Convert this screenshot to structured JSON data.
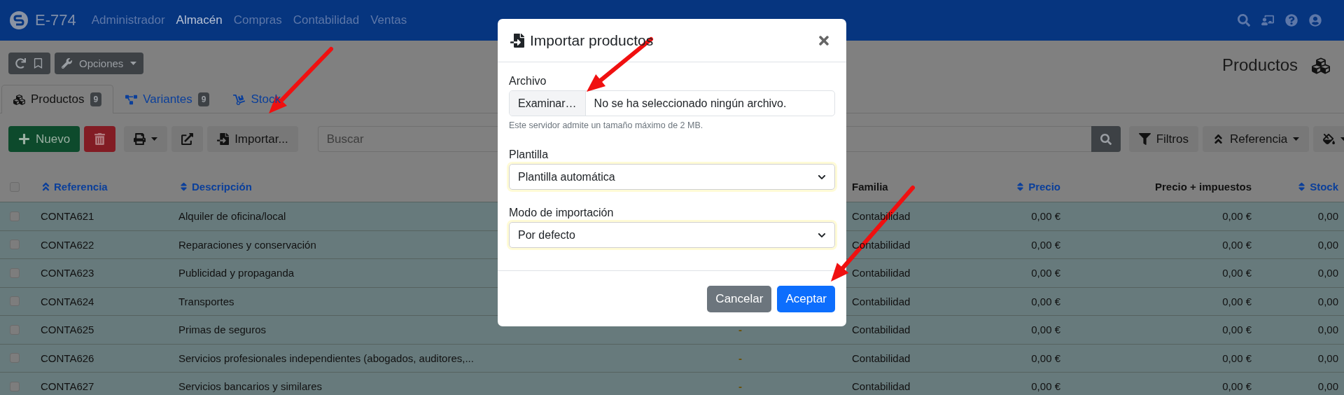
{
  "navbar": {
    "brand": "E-774",
    "menu": [
      {
        "label": "Administrador",
        "selected": false
      },
      {
        "label": "Almacén",
        "selected": true
      },
      {
        "label": "Compras",
        "selected": false
      },
      {
        "label": "Contabilidad",
        "selected": false
      },
      {
        "label": "Ventas",
        "selected": false
      }
    ]
  },
  "toolbar": {
    "options": "Opciones",
    "page_title": "Productos"
  },
  "tabs": [
    {
      "label": "Productos",
      "badge": "9",
      "selected": true,
      "kind": "cubes"
    },
    {
      "label": "Variantes",
      "badge": "9",
      "selected": false,
      "kind": "variants"
    },
    {
      "label": "Stock",
      "selected": false,
      "kind": "stock"
    }
  ],
  "actions": {
    "new": "Nuevo",
    "import": "Importar...",
    "search": {
      "placeholder": "Buscar"
    },
    "filters": "Filtros",
    "sort": "Referencia"
  },
  "table": {
    "select_all": {
      "checked": false
    },
    "columns": [
      {
        "label": "Referencia",
        "sortable": true,
        "sorted": true,
        "kind": "text"
      },
      {
        "label": "Descripción",
        "sortable": true,
        "sorted": false,
        "kind": "text"
      },
      {
        "kind": "text"
      },
      {
        "label": "Familia",
        "sortable": false,
        "sorted": false,
        "kind": "text"
      },
      {
        "label": "Precio",
        "sortable": true,
        "sorted": false,
        "kind": "number"
      },
      {
        "label": "Precio + impuestos",
        "sortable": false,
        "sorted": false,
        "kind": "number"
      },
      {
        "label": "Stock",
        "sortable": true,
        "sorted": false,
        "kind": "number"
      }
    ],
    "rows": [
      {
        "checked": false,
        "cells": [
          "CONTA621",
          "Alquiler de oficina/local",
          "",
          "Contabilidad",
          "0,00 €",
          "0,00 €",
          "0,00"
        ]
      },
      {
        "checked": false,
        "cells": [
          "CONTA622",
          "Reparaciones y conservación",
          "",
          "Contabilidad",
          "0,00 €",
          "0,00 €",
          "0,00"
        ]
      },
      {
        "checked": false,
        "cells": [
          "CONTA623",
          "Publicidad y propaganda",
          "",
          "Contabilidad",
          "0,00 €",
          "0,00 €",
          "0,00"
        ]
      },
      {
        "checked": false,
        "cells": [
          "CONTA624",
          "Transportes",
          "",
          "Contabilidad",
          "0,00 €",
          "0,00 €",
          "0,00"
        ]
      },
      {
        "checked": false,
        "cells": [
          "CONTA625",
          "Primas de seguros",
          "-",
          "Contabilidad",
          "0,00 €",
          "0,00 €",
          "0,00"
        ]
      },
      {
        "checked": false,
        "cells": [
          "CONTA626",
          "Servicios profesionales independientes (abogados, auditores,...",
          "-",
          "Contabilidad",
          "0,00 €",
          "0,00 €",
          "0,00"
        ]
      },
      {
        "checked": false,
        "cells": [
          "CONTA627",
          "Servicios bancarios y similares",
          "-",
          "Contabilidad",
          "0,00 €",
          "0,00 €",
          "0,00"
        ]
      }
    ]
  },
  "dialog": {
    "title": "Importar productos",
    "file": {
      "label": "Archivo",
      "button": "Examinar…",
      "value": "No se ha seleccionado ningún archivo.",
      "help": "Este servidor admite un tamaño máximo de 2 MB."
    },
    "template": {
      "label": "Plantilla",
      "value": "Plantilla automática"
    },
    "mode": {
      "label": "Modo de importación",
      "value": "Por defecto"
    },
    "buttons": [
      {
        "label": "Cancelar",
        "kind": "secondary"
      },
      {
        "label": "Aceptar",
        "kind": "primary"
      }
    ]
  }
}
